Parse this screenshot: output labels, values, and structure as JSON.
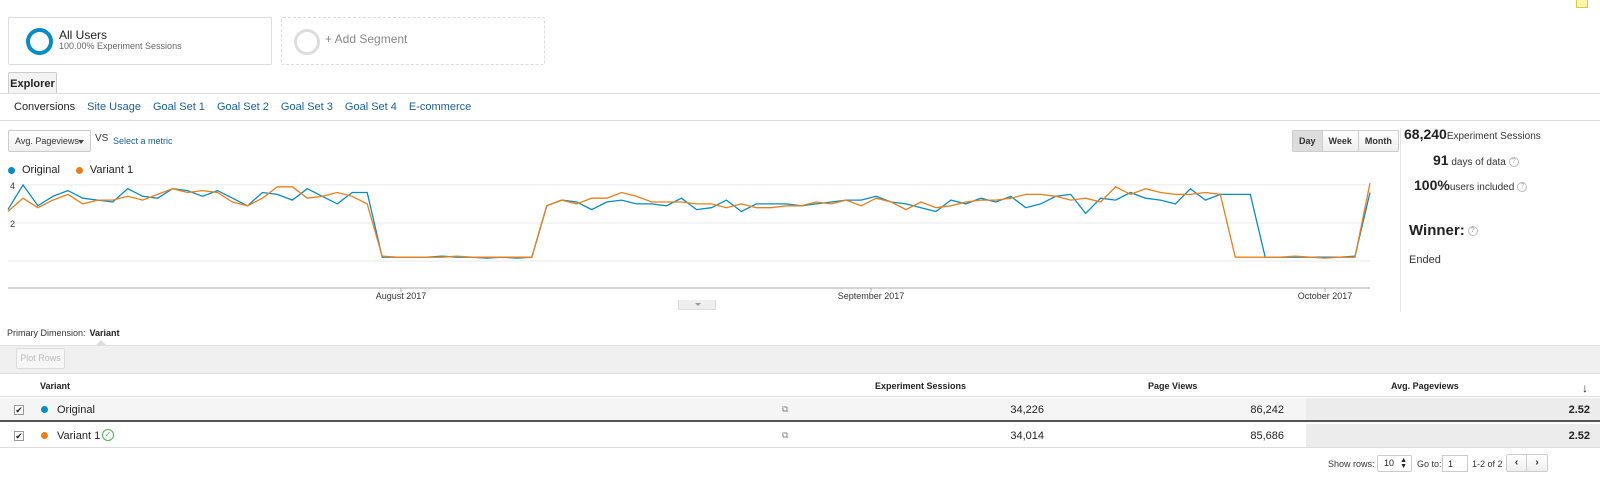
{
  "segments": {
    "all_users": {
      "title": "All Users",
      "subtitle": "100.00% Experiment Sessions"
    },
    "add_segment": "+ Add Segment"
  },
  "tabs": {
    "explorer": "Explorer"
  },
  "subnav": [
    "Conversions",
    "Site Usage",
    "Goal Set 1",
    "Goal Set 2",
    "Goal Set 3",
    "Goal Set 4",
    "E-commerce"
  ],
  "controls": {
    "metric": "Avg. Pageviews",
    "vs": "VS",
    "select_metric": "Select a metric",
    "periods": [
      "Day",
      "Week",
      "Month"
    ],
    "active_period": "Day"
  },
  "legend": [
    {
      "name": "Original",
      "color": "#058dc7"
    },
    {
      "name": "Variant 1",
      "color": "#ed7e17"
    }
  ],
  "chart_data": {
    "type": "line",
    "x_tick_labels": [
      "August 2017",
      "September 2017",
      "October 2017"
    ],
    "y_tick_labels": [
      "4",
      "2"
    ],
    "ylim": [
      0,
      4.1
    ],
    "grid": true,
    "series": [
      {
        "name": "Original",
        "color": "#058dc7",
        "values": [
          2.7,
          4.0,
          2.9,
          3.4,
          3.7,
          3.3,
          3.2,
          3.1,
          3.8,
          3.4,
          3.3,
          3.8,
          3.7,
          3.4,
          3.7,
          3.3,
          2.9,
          3.6,
          3.5,
          3.2,
          3.8,
          3.4,
          3.0,
          3.6,
          3.6,
          0.2,
          0.2,
          0.2,
          0.2,
          0.25,
          0.2,
          0.2,
          0.15,
          0.2,
          0.15,
          0.2,
          2.9,
          3.2,
          3.1,
          2.7,
          3.1,
          3.2,
          3.0,
          3.0,
          2.9,
          3.3,
          2.7,
          2.8,
          3.2,
          2.6,
          3.0,
          3.0,
          3.0,
          2.9,
          3.0,
          3.1,
          3.2,
          3.2,
          3.4,
          3.1,
          3.0,
          2.8,
          2.6,
          3.2,
          3.0,
          3.3,
          3.1,
          3.4,
          2.8,
          3.0,
          3.4,
          3.5,
          2.5,
          3.3,
          3.2,
          3.6,
          3.3,
          3.2,
          3.0,
          3.8,
          3.2,
          3.5,
          3.5,
          3.5,
          0.2,
          0.2,
          0.2,
          0.2,
          0.2,
          0.2,
          0.25,
          3.6
        ],
        "annotate": "value"
      },
      {
        "name": "Variant 1",
        "color": "#ed7e17",
        "values": [
          2.6,
          3.3,
          2.8,
          3.2,
          3.5,
          3.0,
          3.2,
          3.2,
          3.4,
          3.2,
          3.5,
          3.8,
          3.6,
          3.7,
          3.6,
          3.1,
          2.9,
          3.3,
          3.9,
          3.9,
          3.3,
          3.4,
          3.6,
          3.4,
          3.0,
          0.25,
          0.2,
          0.2,
          0.2,
          0.2,
          0.25,
          0.2,
          0.2,
          0.2,
          0.2,
          0.2,
          2.9,
          3.2,
          3.0,
          3.3,
          3.3,
          3.6,
          3.4,
          3.1,
          3.1,
          3.1,
          3.0,
          3.0,
          2.8,
          3.0,
          2.8,
          2.8,
          2.9,
          2.9,
          3.1,
          3.0,
          3.2,
          2.9,
          3.3,
          3.1,
          2.7,
          3.1,
          2.8,
          2.9,
          3.1,
          3.2,
          3.2,
          3.3,
          3.5,
          3.5,
          3.4,
          3.2,
          3.3,
          3.1,
          3.9,
          3.5,
          3.8,
          3.6,
          3.5,
          3.5,
          3.6,
          3.5,
          0.2,
          0.2,
          0.2,
          0.2,
          0.25,
          0.2,
          0.15,
          0.2,
          0.2,
          4.1
        ]
      }
    ]
  },
  "stats": {
    "sessions_value": "68,240",
    "sessions_label": "Experiment Sessions",
    "days_value": "91",
    "days_label": "days of data",
    "users_value": "100%",
    "users_label": "users included",
    "winner_label": "Winner:",
    "status": "Ended"
  },
  "table": {
    "primary_dimension_label": "Primary Dimension:",
    "primary_dimension_value": "Variant",
    "plot_rows": "Plot Rows",
    "headers": [
      "Variant",
      "Experiment Sessions",
      "Page Views",
      "Avg. Pageviews"
    ],
    "rows": [
      {
        "variant": "Original",
        "color": "#058dc7",
        "sessions": "34,226",
        "page_views": "86,242",
        "avg": "2.52"
      },
      {
        "variant": "Variant 1",
        "color": "#ed7e17",
        "sessions": "34,014",
        "page_views": "85,686",
        "avg": "2.52"
      }
    ]
  },
  "pagination": {
    "show_rows_label": "Show rows:",
    "rows_value": "10",
    "goto_label": "Go to:",
    "goto_value": "1",
    "range": "1-2 of 2"
  }
}
